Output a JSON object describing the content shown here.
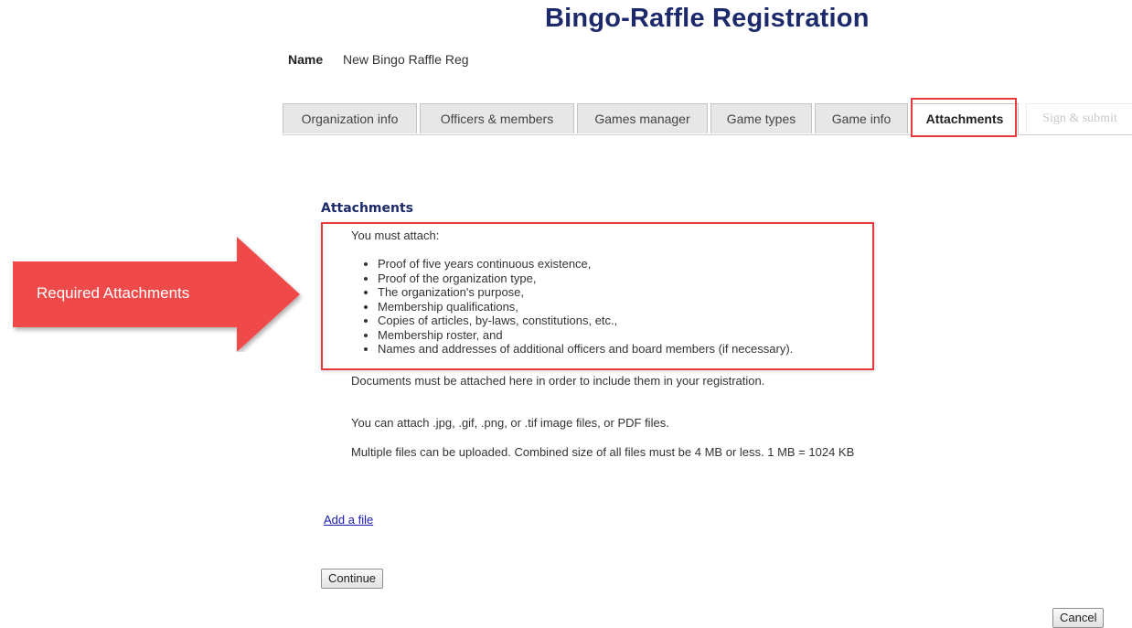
{
  "page": {
    "title": "Bingo-Raffle Registration"
  },
  "registration": {
    "name_label": "Name",
    "name_value": "New Bingo Raffle Reg"
  },
  "tabs": [
    {
      "label": "Organization info",
      "state": "normal"
    },
    {
      "label": "Officers & members",
      "state": "normal"
    },
    {
      "label": "Games manager",
      "state": "normal"
    },
    {
      "label": "Game types",
      "state": "normal"
    },
    {
      "label": "Game info",
      "state": "normal"
    },
    {
      "label": "Attachments",
      "state": "active"
    },
    {
      "label": "Sign & submit",
      "state": "disabled"
    }
  ],
  "attachments": {
    "heading": "Attachments",
    "intro": "You must attach:",
    "requirements": [
      "Proof of five years continuous existence,",
      "Proof of the organization type,",
      "The organization's purpose,",
      "Membership qualifications,",
      "Copies of articles, by-laws, constitutions, etc.,",
      "Membership roster, and",
      "Names and addresses of additional officers and board members (if necessary)."
    ],
    "documents_note": "Documents must be attached here in order to include them in your registration.",
    "file_types_note": "You can attach .jpg, .gif, .png, or .tif image files, or PDF files.",
    "size_note": "Multiple files can be uploaded. Combined size of all files must be 4 MB or less. 1 MB = 1024 KB",
    "add_file_link": "Add a file"
  },
  "actions": {
    "continue_label": "Continue",
    "cancel_label": "Cancel"
  },
  "annotation": {
    "callout_label": "Required Attachments"
  },
  "colors": {
    "title": "#1c2a6b",
    "highlight": "#e63b3b",
    "callout_fill": "#f04a48",
    "link": "#1a1ab8"
  }
}
